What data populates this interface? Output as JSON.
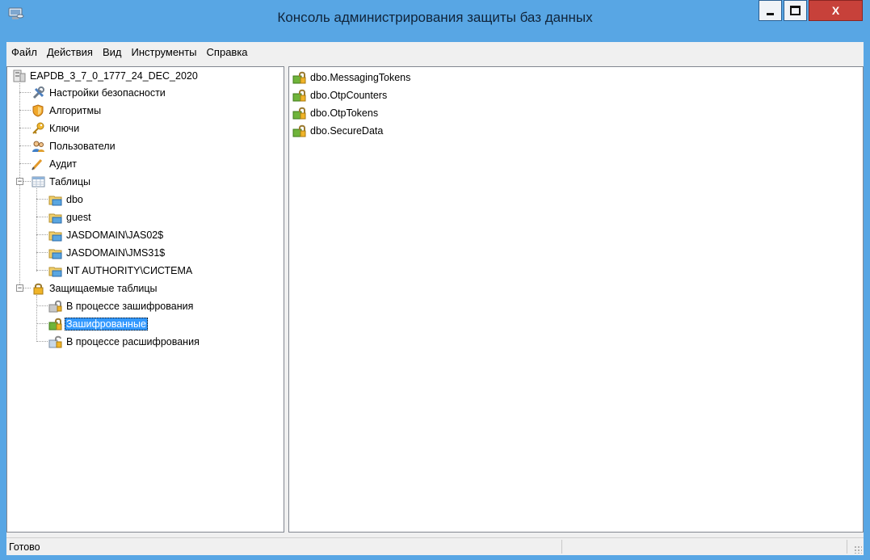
{
  "window": {
    "title": "Консоль администрирования защиты баз данных",
    "controls": {
      "minimize": "minimize-icon",
      "maximize": "maximize-icon",
      "close_label": "X"
    }
  },
  "menu": [
    "Файл",
    "Действия",
    "Вид",
    "Инструменты",
    "Справка"
  ],
  "tree": {
    "root": "EAPDB_3_7_0_1777_24_DEC_2020",
    "items": [
      {
        "label": "Настройки безопасности",
        "icon": "tools-icon"
      },
      {
        "label": "Алгоритмы",
        "icon": "shield-icon"
      },
      {
        "label": "Ключи",
        "icon": "key-icon"
      },
      {
        "label": "Пользователи",
        "icon": "users-icon"
      },
      {
        "label": "Аудит",
        "icon": "pencil-icon"
      }
    ],
    "tables": {
      "label": "Таблицы",
      "expanded": true,
      "children": [
        "dbo",
        "guest",
        "JASDOMAIN\\JAS02$",
        "JASDOMAIN\\JMS31$",
        "NT AUTHORITY\\СИСТЕМА"
      ]
    },
    "protected": {
      "label": "Защищаемые таблицы",
      "expanded": true,
      "children": [
        "В процессе зашифрования",
        "Зашифрованные",
        "В процессе расшифрования"
      ],
      "selected": "Зашифрованные"
    }
  },
  "list": {
    "items": [
      "dbo.MessagingTokens",
      "dbo.OtpCounters",
      "dbo.OtpTokens",
      "dbo.SecureData"
    ]
  },
  "status": {
    "text": "Готово"
  },
  "colors": {
    "frame": "#58a6e4",
    "selection": "#3399ff",
    "close": "#c7413a"
  }
}
